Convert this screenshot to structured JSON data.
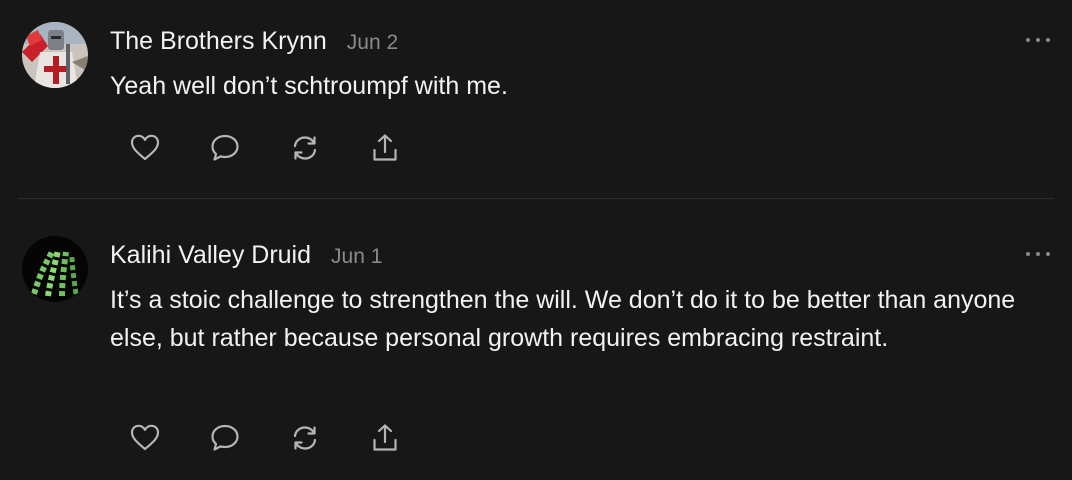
{
  "comments": [
    {
      "author": "The Brothers Krynn",
      "date": "Jun 2",
      "text": "Yeah well don’t schtroumpf with me.",
      "avatar_icon": "knight-avatar"
    },
    {
      "author": "Kalihi Valley Druid",
      "date": "Jun 1",
      "text": "It’s a stoic challenge to strengthen the will. We don’t do it to be better than anyone else, but rather because personal growth requires embracing restraint.",
      "avatar_icon": "green-fronds-avatar"
    }
  ],
  "actions": [
    "heart-icon",
    "comment-icon",
    "restack-icon",
    "share-icon"
  ],
  "colors": {
    "background": "#171717",
    "text": "#f2f2f2",
    "muted": "#8a8a8a",
    "icon": "#b5b5b5"
  }
}
